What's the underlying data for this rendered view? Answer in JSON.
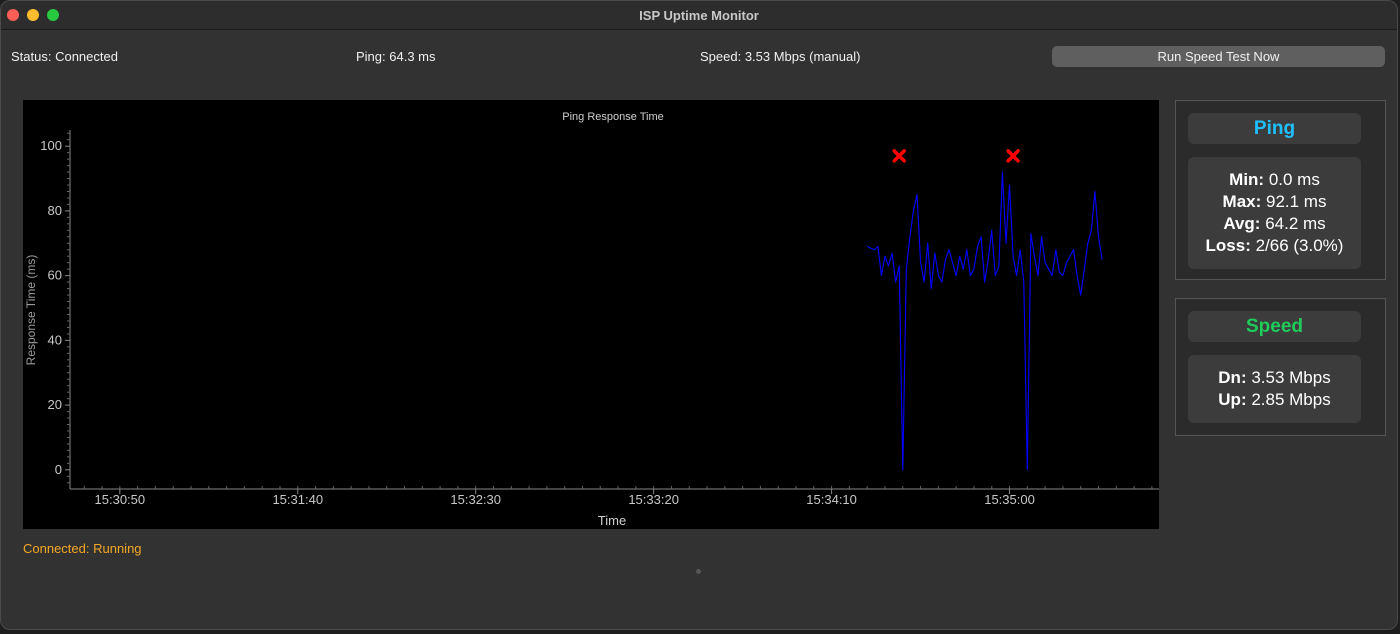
{
  "window": {
    "title": "ISP Uptime Monitor"
  },
  "top": {
    "status": "Status: Connected",
    "ping": "Ping: 64.3 ms",
    "speed": "Speed: 3.53 Mbps (manual)",
    "run_button": "Run Speed Test Now"
  },
  "chart_data": {
    "type": "line",
    "title": "Ping Response Time",
    "xlabel": "Time",
    "ylabel": "Response Time (ms)",
    "ylim": [
      -5,
      105
    ],
    "yticks": [
      0,
      20,
      40,
      60,
      80,
      100
    ],
    "xticks": [
      "15:30:50",
      "15:31:40",
      "15:32:30",
      "15:33:20",
      "15:34:10",
      "15:35:00"
    ],
    "xtick_seconds": [
      50,
      100,
      150,
      200,
      250,
      300
    ],
    "xlim_seconds": [
      36,
      342
    ],
    "grid": false,
    "line_color": "#0000ff",
    "marker_color": "#ff0000",
    "series": [
      {
        "x_seconds": [
          260,
          262,
          263,
          264,
          265,
          266,
          267,
          268,
          269,
          270,
          271,
          272,
          273,
          274,
          275,
          276,
          277,
          278,
          279,
          280,
          281,
          282,
          283,
          284,
          285,
          286,
          287,
          288,
          289,
          290,
          291,
          292,
          293,
          294,
          295,
          296,
          297,
          298,
          299,
          300,
          301,
          302,
          303,
          304,
          305,
          306,
          307,
          308,
          309,
          310,
          311,
          312,
          313,
          314,
          315,
          316,
          317,
          318,
          319,
          320,
          321,
          322,
          323,
          324,
          325,
          326
        ],
        "values": [
          69,
          68,
          69,
          60,
          66,
          63,
          67,
          58,
          63,
          0,
          62,
          72,
          80,
          85,
          64,
          58,
          70,
          56,
          67,
          60,
          58,
          65,
          68,
          64,
          60,
          66,
          62,
          68,
          60,
          62,
          69,
          72,
          58,
          65,
          74,
          60,
          63,
          92,
          70,
          88,
          66,
          60,
          68,
          58,
          0,
          73,
          66,
          60,
          72,
          64,
          62,
          60,
          68,
          61,
          60,
          64,
          66,
          68,
          60,
          54,
          62,
          70,
          74,
          86,
          72,
          65
        ]
      }
    ],
    "loss_markers_seconds": [
      269,
      301
    ],
    "loss_markers_value": 97
  },
  "ping_panel": {
    "header": "Ping",
    "header_color": "#1ec0ff",
    "min_label": "Min:",
    "min_value": " 0.0 ms",
    "max_label": "Max:",
    "max_value": " 92.1 ms",
    "avg_label": "Avg:",
    "avg_value": " 64.2 ms",
    "loss_label": "Loss:",
    "loss_value": " 2/66 (3.0%)"
  },
  "speed_panel": {
    "header": "Speed",
    "header_color": "#1ecc5a",
    "dn_label": "Dn:",
    "dn_value": " 3.53 Mbps",
    "up_label": "Up:",
    "up_value": " 2.85 Mbps"
  },
  "footer": {
    "status": "Connected: Running",
    "status_color": "#f5a623"
  }
}
